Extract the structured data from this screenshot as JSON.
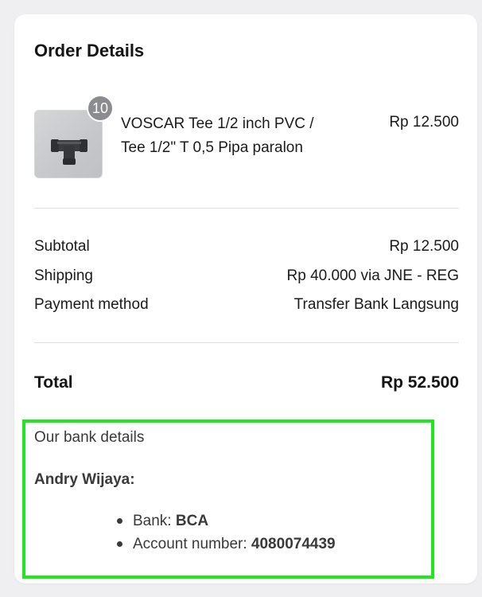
{
  "order": {
    "title": "Order Details",
    "item": {
      "quantity": "10",
      "name": "VOSCAR Tee 1/2 inch PVC / Tee 1/2\" T 0,5 Pipa paralon",
      "price": "Rp 12.500",
      "thumbnail_icon": "pvc-tee-fitting-image"
    },
    "summary": {
      "subtotal_label": "Subtotal",
      "subtotal_value": "Rp 12.500",
      "shipping_label": "Shipping",
      "shipping_value": "Rp 40.000 via JNE - REG",
      "payment_label": "Payment method",
      "payment_value": "Transfer Bank Langsung"
    },
    "total": {
      "label": "Total",
      "value": "Rp 52.500"
    }
  },
  "bank": {
    "heading": "Our bank details",
    "account_name": "Andry Wijaya:",
    "bank_label": "Bank:",
    "bank_value": "BCA",
    "account_number_label": "Account number:",
    "account_number_value": "4080074439"
  },
  "colors": {
    "highlight_border": "#21e81c",
    "badge": "#8b8c8f",
    "background": "#efeff1"
  }
}
